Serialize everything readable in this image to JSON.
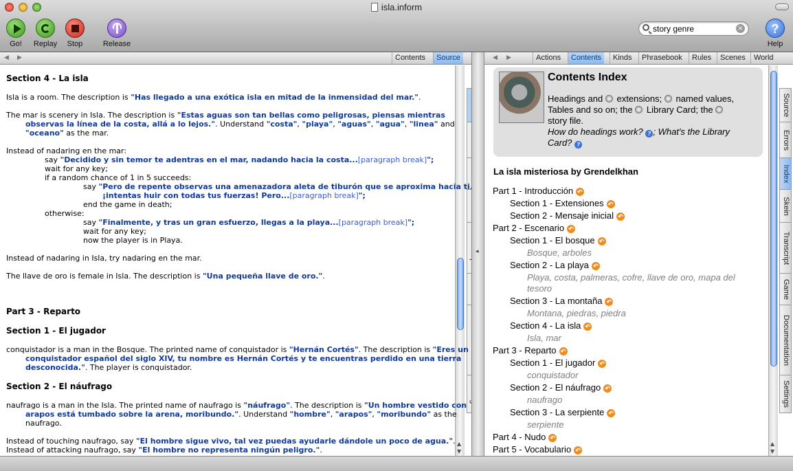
{
  "window": {
    "title": "isla.inform"
  },
  "toolbar": {
    "go": "Go!",
    "replay": "Replay",
    "stop": "Stop",
    "release": "Release",
    "help": "Help"
  },
  "search": {
    "value": "story genre"
  },
  "left": {
    "tabs": [
      "Contents",
      "Source"
    ],
    "selected_tab": "Source"
  },
  "right": {
    "tabs": [
      "Actions",
      "Contents",
      "Kinds",
      "Phrasebook",
      "Rules",
      "Scenes",
      "World"
    ],
    "selected_tab": "Contents"
  },
  "side_tabs": [
    "Source",
    "Errors",
    "Index",
    "Skein",
    "Transcript",
    "Game",
    "Documentation",
    "Settings"
  ],
  "left_side_selected": "Source",
  "right_side_selected": "Index",
  "source": {
    "h1": "Section 4 - La isla",
    "p1a": "Isla is a room. The description is ",
    "p1q": "\"Has llegado a una exótica isla en mitad de la inmensidad del mar.\"",
    "p1b": ".",
    "p2a": "The mar is scenery in Isla. The description is ",
    "p2q1": "\"Estas aguas son tan bellas como peligrosas, piensas mientras",
    "p2q2": "observas la línea de la costa, allá a lo lejos.\"",
    "p2b": ". Understand ",
    "p2c1": "\"costa\"",
    "p2c2": "\"playa\"",
    "p2c3": "\"aguas\"",
    "p2c4": "\"agua\"",
    "p2c5": "\"linea\"",
    "p2and": " and",
    "p2c6": "\"oceano\"",
    "p2end": " as the mar.",
    "r0": "Instead of nadaring en the mar:",
    "r1a": "say ",
    "r1q": "\"Decidido y sin temor te adentras en el mar, nadando hacia la costa...",
    "r1pb": "[paragraph break]",
    "r1e": "\";",
    "r2": "wait for any key;",
    "r3": "if a random chance of 1 in 5 succeeds:",
    "r4a": "say ",
    "r4q1": "\"Pero de repente observas una amenazadora aleta de tiburón que se aproxima hacia ti...",
    "r4q2": "¡intentas huir con todas tus fuerzas! Pero...",
    "r4pb": "[paragraph break]",
    "r4e": "\";",
    "r5": "end the game in death;",
    "r6": "otherwise:",
    "r7a": "say ",
    "r7q": "\"Finalmente, y tras un gran esfuerzo, llegas a la playa...",
    "r7pb": "[paragraph break]",
    "r7e": "\";",
    "r8": "wait for any key;",
    "r9": "now the player is in Playa.",
    "p3": "Instead of nadaring in Isla, try nadaring en the mar.",
    "p4a": "The llave de oro is female in Isla. The description is ",
    "p4q": "\"Una pequeña llave de oro.\"",
    "p4b": ".",
    "h2": "Part 3 - Reparto",
    "h3": "Section 1 - El jugador",
    "p5a": "conquistador is a man in the Bosque. The printed name of conquistador is ",
    "p5q": "\"Hernán Cortés\"",
    "p5b": ". The description is ",
    "p5q1": "\"Eres un",
    "p5q2": "conquistador español del siglo XIV, tu nombre es Hernán Cortés y te encuentras perdido en una tierra",
    "p5q3": "desconocida.\"",
    "p5c": ". The player is conquistador.",
    "h4": "Section 2 - El náufrago",
    "p6a": "naufrago is a man in the Isla. The printed name of naufrago is ",
    "p6q": "\"náufrago\"",
    "p6b": ". The description is ",
    "p6q1": "\"Un hombre vestido con",
    "p6q2": "arapos está tumbado sobre la arena, moribundo.\"",
    "p6c": ". Understand ",
    "p6d1": "\"hombre\"",
    "p6d2": "\"arapos\"",
    "p6d3": "\"moribundo\"",
    "p6e": " as the",
    "p6f": "naufrago.",
    "p7a": "Instead of touching naufrago, say ",
    "p7q": "\"El hombre sigue vivo, tal vez puedas ayudarle dándole un poco de agua.\"",
    "p7b": ".",
    "p8a": "Instead of attacking naufrago, say ",
    "p8q": "\"El hombre no representa ningún peligro.\"",
    "p8b": "."
  },
  "contents_index": {
    "title": "Contents Index",
    "l1a": "Headings and",
    "l1b": "extensions;",
    "l1c": "named values,",
    "l2a": "Tables and so on; the",
    "l2b": "Library Card; the",
    "l3": "story file.",
    "l4a": "How do headings work?",
    "l4b": "; What's the Library",
    "l5": "Card?",
    "story_title": "La isla misteriosa by Grendelkhan",
    "entries": [
      "Part 1 - Introducción",
      "Section 1 - Extensiones",
      "Section 2 - Mensaje inicial",
      "Part 2 - Escenario",
      "Section 1 - El bosque",
      "Bosque, arboles",
      "Section 2 - La playa",
      "Playa, costa, palmeras, cofre, llave de oro, mapa del",
      "tesoro",
      "Section 3 - La montaña",
      "Montana, piedras, piedra",
      "Section 4 - La isla",
      "Isla, mar",
      "Part 3 - Reparto",
      "Section 1 - El jugador",
      "conquistador",
      "Section 2 - El náufrago",
      "naufrago",
      "Section 3 - La serpiente",
      "serpiente",
      "Part 4 - Nudo",
      "Part 5 - Vocabulario"
    ]
  },
  "colors": {
    "quote": "#0f3a9a",
    "accent": "#8fb8ea",
    "go": "#3d9a1f",
    "stop": "#c8251e",
    "release": "#7a4fc6",
    "help": "#3a72d8",
    "link": "#f08c1a"
  },
  "icons": {
    "go": "play-icon",
    "replay": "replay-icon",
    "stop": "stop-icon",
    "release": "release-icon",
    "help": "help-icon"
  }
}
